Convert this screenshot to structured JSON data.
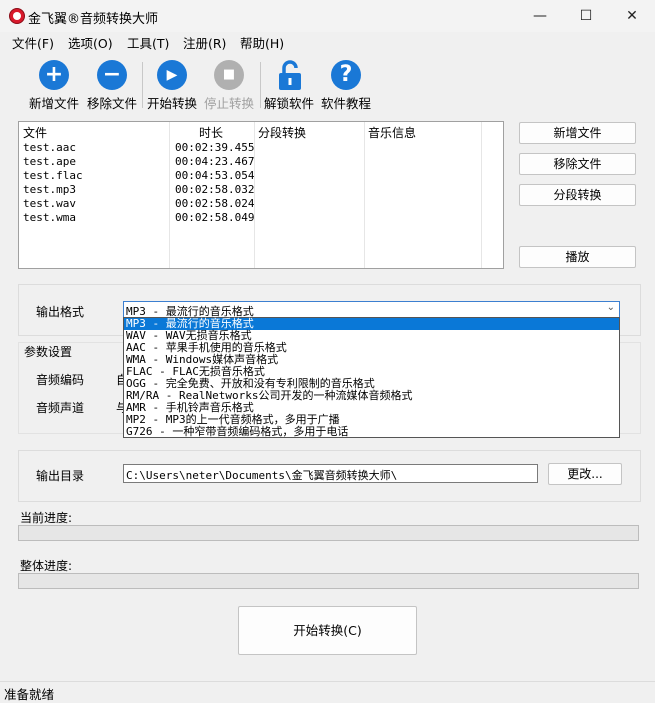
{
  "window": {
    "title": "金飞翼®音频转换大师",
    "minimize": "—",
    "maximize": "☐",
    "close": "✕"
  },
  "menu": [
    "文件(F)",
    "选项(O)",
    "工具(T)",
    "注册(R)",
    "帮助(H)"
  ],
  "toolbar": {
    "add_label": "新增文件",
    "remove_label": "移除文件",
    "start_label": "开始转换",
    "stop_label": "停止转换",
    "unlock_label": "解锁软件",
    "tutorial_label": "软件教程",
    "add_glyph": "+",
    "remove_glyph": "−",
    "start_glyph": "▶",
    "stop_glyph": "■",
    "tutorial_glyph": "?",
    "colors": {
      "primary": "#1a78d6",
      "disabled": "#b0b0b0"
    }
  },
  "filelist": {
    "columns": [
      "文件",
      "时长",
      "分段转换",
      "音乐信息"
    ],
    "rows": [
      {
        "file": "test.aac",
        "duration": "00:02:39.455"
      },
      {
        "file": "test.ape",
        "duration": "00:04:23.467"
      },
      {
        "file": "test.flac",
        "duration": "00:04:53.054"
      },
      {
        "file": "test.mp3",
        "duration": "00:02:58.032"
      },
      {
        "file": "test.wav",
        "duration": "00:02:58.024"
      },
      {
        "file": "test.wma",
        "duration": "00:02:58.049"
      }
    ]
  },
  "side_buttons": {
    "add": "新增文件",
    "remove": "移除文件",
    "segment": "分段转换",
    "play": "播放"
  },
  "output_format": {
    "label": "输出格式",
    "selected": "MP3 - 最流行的音乐格式",
    "options": [
      "MP3 - 最流行的音乐格式",
      "WAV - WAV无损音乐格式",
      "AAC - 苹果手机使用的音乐格式",
      "WMA - Windows媒体声音格式",
      "FLAC - FLAC无损音乐格式",
      "OGG - 完全免费、开放和没有专利限制的音乐格式",
      "RM/RA - RealNetworks公司开发的一种流媒体音频格式",
      "AMR - 手机铃声音乐格式",
      "MP2 - MP3的上一代音频格式，多用于广播",
      "G726 - 一种窄带音频编码格式，多用于电话"
    ]
  },
  "params": {
    "title": "参数设置",
    "codec_label": "音频编码",
    "channel_label": "音频声道",
    "codec_partial": "自",
    "channel_partial": "与"
  },
  "output_dir": {
    "label": "输出目录",
    "path": "C:\\Users\\neter\\Documents\\金飞翼音频转换大师\\",
    "change": "更改..."
  },
  "progress": {
    "current_label": "当前进度:",
    "overall_label": "整体进度:",
    "current": 0,
    "overall": 0
  },
  "start_button": "开始转换(C)",
  "status": "准备就绪"
}
